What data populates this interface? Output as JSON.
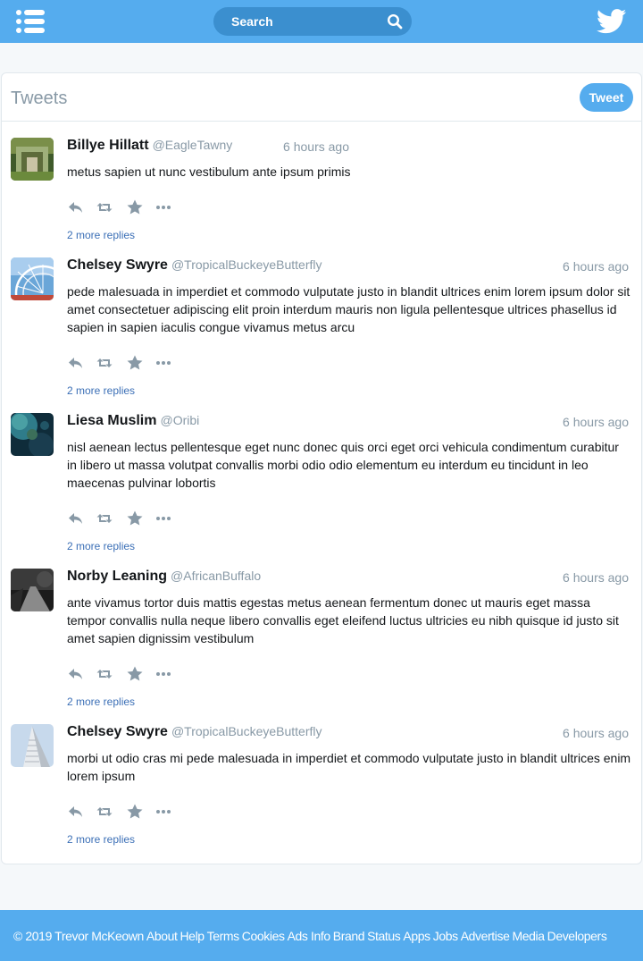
{
  "header": {
    "search_placeholder": "Search",
    "colors": {
      "brand": "#55acee",
      "search_bg": "#3b8fcf"
    },
    "icons": [
      "menu-icon",
      "search-icon",
      "twitter-bird-icon"
    ]
  },
  "feed": {
    "title": "Tweets",
    "tweet_button": "Tweet",
    "tweets": [
      {
        "name": "Billye Hillatt",
        "handle": "@EagleTawny",
        "time": "6 hours ago",
        "text": "metus sapien ut nunc vestibulum ante ipsum primis",
        "more_replies": "2 more replies"
      },
      {
        "name": "Chelsey Swyre",
        "handle": "@TropicalBuckeyeButterfly",
        "time": "6 hours ago",
        "text": "pede malesuada in imperdiet et commodo vulputate justo in blandit ultrices enim lorem ipsum dolor sit amet consectetuer adipiscing elit proin interdum mauris non ligula pellentesque ultrices phasellus id sapien in sapien iaculis congue vivamus metus arcu",
        "more_replies": "2 more replies"
      },
      {
        "name": "Liesa Muslim",
        "handle": "@Oribi",
        "time": "6 hours ago",
        "text": "nisl aenean lectus pellentesque eget nunc donec quis orci eget orci vehicula condimentum curabitur in libero ut massa volutpat convallis morbi odio odio elementum eu interdum eu tincidunt in leo maecenas pulvinar lobortis",
        "more_replies": "2 more replies"
      },
      {
        "name": "Norby Leaning",
        "handle": "@AfricanBuffalo",
        "time": "6 hours ago",
        "text": "ante vivamus tortor duis mattis egestas metus aenean fermentum donec ut mauris eget massa tempor convallis nulla neque libero convallis eget eleifend luctus ultricies eu nibh quisque id justo sit amet sapien dignissim vestibulum",
        "more_replies": "2 more replies"
      },
      {
        "name": "Chelsey Swyre",
        "handle": "@TropicalBuckeyeButterfly",
        "time": "6 hours ago",
        "text": "morbi ut odio cras mi pede malesuada in imperdiet et commodo vulputate justo in blandit ultrices enim lorem ipsum",
        "more_replies": "2 more replies"
      }
    ]
  },
  "footer": {
    "copyright": "© 2019 Trevor McKeown",
    "links": [
      "About",
      "Help",
      "Terms",
      "Cookies",
      "Ads Info",
      "Brand",
      "Status",
      "Apps",
      "Jobs",
      "Advertise",
      "Media",
      "Developers"
    ]
  }
}
